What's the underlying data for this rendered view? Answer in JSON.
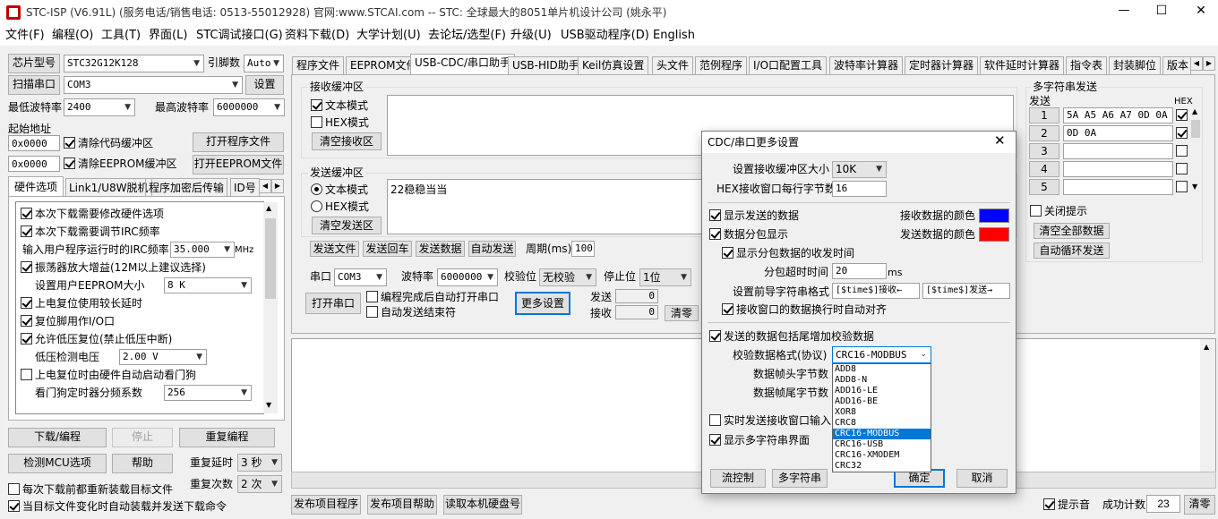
{
  "window": {
    "title": "STC-ISP (V6.91L) (服务电话/销售电话: 0513-55012928) 官网:www.STCAI.com  -- STC: 全球最大的8051单片机设计公司 (姚永平)",
    "minimize": "—",
    "maximize": "☐",
    "close": "✕"
  },
  "menu": [
    "文件(F)",
    "编程(O)",
    "工具(T)",
    "界面(L)",
    "STC调试接口(G)",
    "资料下载(D)",
    "大学计划(U)",
    "去论坛/选型(F)",
    "升级(U)",
    "USB驱动程序(D)",
    "English"
  ],
  "left": {
    "chip_label": "芯片型号",
    "chip_value": "STC32G12K128",
    "pin_label": "引脚数",
    "pin_value": "Auto",
    "scan_button": "扫描串口",
    "port_value": "COM3",
    "settings_button": "设置",
    "min_baud_label": "最低波特率",
    "min_baud_value": "2400",
    "max_baud_label": "最高波特率",
    "max_baud_value": "6000000",
    "start_addr_label": "起始地址",
    "addr1": "0x0000",
    "clear_code": "清除代码缓冲区",
    "open_program": "打开程序文件",
    "addr2": "0x0000",
    "clear_eeprom": "清除EEPROM缓冲区",
    "open_eeprom": "打开EEPROM文件",
    "tabs": [
      "硬件选项",
      "Link1/U8W脱机",
      "程序加密后传输",
      "ID号"
    ],
    "options": {
      "opt1": "本次下载需要修改硬件选项",
      "opt2": "本次下载需要调节IRC频率",
      "irc_label": "输入用户程序运行时的IRC频率",
      "irc_value": "35.000",
      "irc_unit": "MHz",
      "opt3": "振荡器放大增益(12M以上建议选择)",
      "eeprom_label": "设置用户EEPROM大小",
      "eeprom_value": "8    K",
      "opt4": "上电复位使用较长延时",
      "opt5": "复位脚用作I/O口",
      "opt6": "允许低压复位(禁止低压中断)",
      "lv_label": "低压检测电压",
      "lv_value": "2.00 V",
      "opt7": "上电复位时由硬件自动启动看门狗",
      "wdt_label": "看门狗定时器分频系数",
      "wdt_value": "256"
    },
    "download": "下载/编程",
    "stop": "停止",
    "reprogram": "重复编程",
    "check_mcu": "检测MCU选项",
    "help": "帮助",
    "repeat_delay_label": "重复延时",
    "repeat_delay_value": "3 秒",
    "repeat_count_label": "重复次数",
    "repeat_count_value": "2 次",
    "reload_each": "每次下载前都重新装载目标文件",
    "auto_reload": "当目标文件变化时自动装载并发送下载命令"
  },
  "main_tabs": [
    "程序文件",
    "EEPROM文件",
    "USB-CDC/串口助手",
    "USB-HID助手",
    "Keil仿真设置",
    "头文件",
    "范例程序",
    "I/O口配置工具",
    "波特率计算器",
    "定时器计算器",
    "软件延时计算器",
    "指令表",
    "封装脚位",
    "版本"
  ],
  "assistant": {
    "recv_group": "接收缓冲区",
    "recv_text_mode": "文本模式",
    "recv_hex_mode": "HEX模式",
    "clear_recv": "清空接收区",
    "send_group": "发送缓冲区",
    "send_text_mode": "文本模式",
    "send_hex_mode": "HEX模式",
    "clear_send": "清空发送区",
    "send_content": "22稳稳当当",
    "send_file": "发送文件",
    "send_enter": "发送回车",
    "send_data": "发送数据",
    "auto_send": "自动发送",
    "period_label": "周期(ms)",
    "period_value": "100",
    "port_label": "串口",
    "port_value": "COM3",
    "baud_label": "波特率",
    "baud_value": "6000000",
    "parity_label": "校验位",
    "parity_value": "无校验",
    "stop_label": "停止位",
    "stop_value": "1位",
    "open_port": "打开串口",
    "auto_open": "编程完成后自动打开串口",
    "auto_end": "自动发送结束符",
    "more_settings": "更多设置",
    "tx_label": "发送",
    "tx_value": "0",
    "rx_label": "接收",
    "rx_value": "0",
    "clear_count": "清零"
  },
  "multi": {
    "title": "多字符串发送",
    "send_col": "发送",
    "hex_col": "HEX",
    "rows": [
      {
        "num": "1",
        "text": "5A A5 A6 A7 0D 0A",
        "hex": true
      },
      {
        "num": "2",
        "text": "0D 0A",
        "hex": true
      },
      {
        "num": "3",
        "text": "",
        "hex": false
      },
      {
        "num": "4",
        "text": "",
        "hex": false
      },
      {
        "num": "5",
        "text": "",
        "hex": false
      }
    ],
    "close_hint": "关闭提示",
    "clear_all": "清空全部数据",
    "auto_loop": "自动循环发送"
  },
  "bottom": {
    "publish": "发布项目程序",
    "publish_help": "发布项目帮助",
    "read_disk": "读取本机硬盘号",
    "sound": "提示音",
    "success_label": "成功计数",
    "success_value": "23",
    "clear": "清零"
  },
  "dialog": {
    "title": "CDC/串口更多设置",
    "recv_buf_label": "设置接收缓冲区大小",
    "recv_buf_value": "10K",
    "hex_bytes_label": "HEX接收窗口每行字节数",
    "hex_bytes_value": "16",
    "show_sent": "显示发送的数据",
    "recv_color_label": "接收数据的颜色",
    "recv_color": "#0000ff",
    "packet_show": "数据分包显示",
    "send_color_label": "发送数据的颜色",
    "send_color": "#ff0000",
    "show_packet_time": "显示分包数据的收发时间",
    "packet_timeout_label": "分包超时时间",
    "packet_timeout_value": "20",
    "packet_timeout_unit": "ms",
    "prefix_label": "设置前导字符串格式",
    "prefix_recv": "[$time$]接收←",
    "prefix_send": "[$time$]发送→",
    "auto_align": "接收窗口的数据换行时自动对齐",
    "add_checksum": "发送的数据包括尾增加校验数据",
    "checksum_format_label": "校验数据格式(协议)",
    "checksum_format_value": "CRC16-MODBUS",
    "frame_head_label": "数据帧头字节数",
    "frame_tail_label": "数据帧尾字节数",
    "checksum_options": [
      "ADD8",
      "ADD8-N",
      "ADD16-LE",
      "ADD16-BE",
      "XOR8",
      "CRC8",
      "CRC16-MODBUS",
      "CRC16-USB",
      "CRC16-XMODEM",
      "CRC32"
    ],
    "selected_index": 6,
    "realtime_send": "实时发送接收窗口输入",
    "show_multi": "显示多字符串界面",
    "flow_control": "流控制",
    "multi_string": "多字符串",
    "ok": "确定",
    "cancel": "取消"
  }
}
